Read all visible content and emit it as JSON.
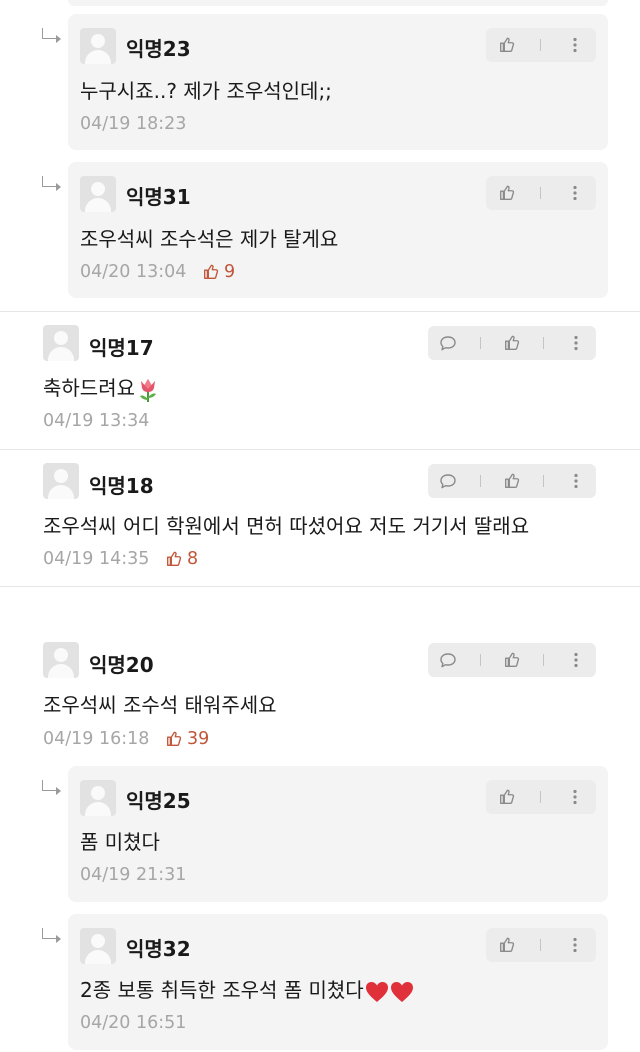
{
  "comments": [
    {
      "nick": "익명23",
      "text": "누구시죠..? 제가 조우석인데;;",
      "time": "04/19 18:23",
      "likes": ""
    },
    {
      "nick": "익명31",
      "text": "조우석씨 조수석은 제가 탈게요",
      "time": "04/20 13:04",
      "likes": "9"
    },
    {
      "nick": "익명17",
      "text": "축하드려요",
      "time": "04/19 13:34",
      "likes": ""
    },
    {
      "nick": "익명18",
      "text": "조우석씨 어디 학원에서 면허 따셨어요 저도 거기서 딸래요",
      "time": "04/19 14:35",
      "likes": "8"
    },
    {
      "nick": "익명20",
      "text": "조우석씨 조수석 태워주세요",
      "time": "04/19 16:18",
      "likes": "39"
    },
    {
      "nick": "익명25",
      "text": "폼 미쳤다",
      "time": "04/19 21:31",
      "likes": ""
    },
    {
      "nick": "익명32",
      "text": "2종 보통 취득한 조우석 폼 미쳤다",
      "time": "04/20 16:51",
      "likes": ""
    }
  ],
  "icons": {
    "like": "thumbs-up-icon",
    "more": "more-vertical-icon",
    "reply": "speech-bubble-icon",
    "emoji_flower": "tulip-emoji",
    "emoji_heart": "red-heart-emoji"
  },
  "colors": {
    "likes": "#c0563a",
    "time": "#a6a6a6",
    "reply_bg": "#f4f4f4",
    "action_bg": "#ececec"
  }
}
